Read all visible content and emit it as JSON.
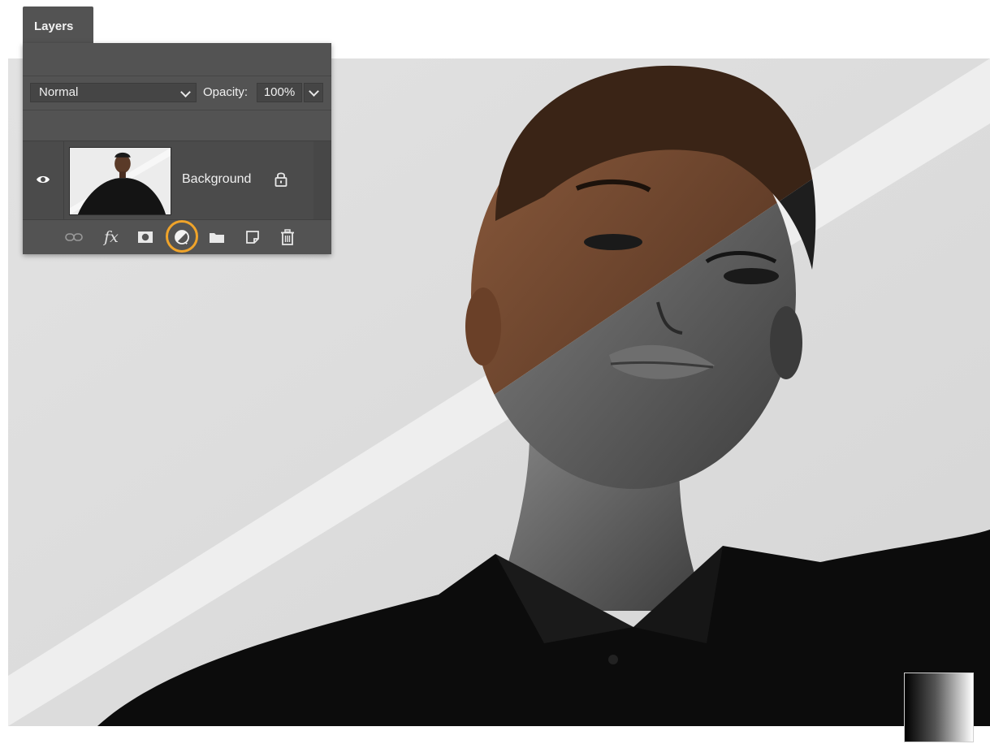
{
  "panel": {
    "tab_label": "Layers",
    "blend_mode": "Normal",
    "opacity_label": "Opacity:",
    "opacity_value": "100%"
  },
  "layer": {
    "name": "Background",
    "visible": true,
    "locked": true
  },
  "toolbar": {
    "fx_label": "fx",
    "buttons": [
      "link-layers-icon",
      "add-layer-style-icon",
      "add-mask-icon",
      "new-fill-adjustment-layer-icon",
      "new-group-icon",
      "new-layer-icon",
      "delete-layer-icon"
    ],
    "highlighted_button": "new-fill-adjustment-layer-icon"
  },
  "colors": {
    "panel_bg": "#535353",
    "highlight": "#f0a42a"
  }
}
